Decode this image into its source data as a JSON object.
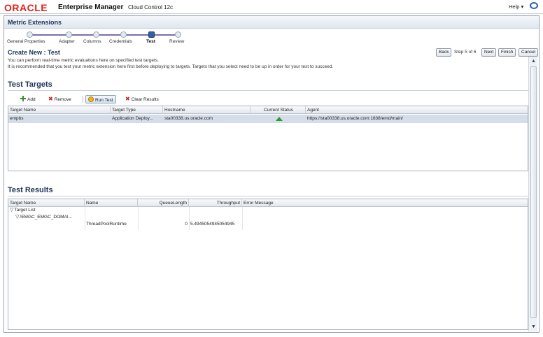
{
  "header": {
    "logo": "ORACLE",
    "product": "Enterprise Manager",
    "edition": "Cloud Control 12c",
    "help": "Help ▾"
  },
  "region": {
    "title": "Metric Extensions"
  },
  "train": {
    "steps": [
      {
        "label": "General Properties",
        "active": false
      },
      {
        "label": "Adapter",
        "active": false
      },
      {
        "label": "Columns",
        "active": false
      },
      {
        "label": "Credentials",
        "active": false
      },
      {
        "label": "Test",
        "active": true
      },
      {
        "label": "Review",
        "active": false
      }
    ]
  },
  "page": {
    "title": "Create New : Test",
    "desc1": "You can perform real-time metric evaluations here on specified test targets.",
    "desc2": "It is recommended that you test your metric extension here first before deploying to targets. Targets that you select need to be up in order for your test to succeed."
  },
  "nav": {
    "back": "Back",
    "step": "Step 5 of 6",
    "next": "Next",
    "finish": "Finish",
    "cancel": "Cancel"
  },
  "targets": {
    "title": "Test Targets",
    "toolbar": {
      "add": "Add",
      "remove": "Remove",
      "run": "Run Test",
      "clear": "Clear Results"
    },
    "columns": [
      "Target Name",
      "Target Type",
      "Hostname",
      "Current Status",
      "Agent"
    ],
    "rows": [
      {
        "name": "empbs",
        "type": "Application Deploy...",
        "host": "sta00338.us.oracle.com",
        "status": "up",
        "agent": "https://sta00338.us.oracle.com:1838/emd/main/"
      }
    ]
  },
  "results": {
    "title": "Test Results",
    "columns": [
      "Target Name",
      "Name",
      "QueueLength",
      "Throughput",
      "Error Message"
    ],
    "tree": {
      "root": "Target List",
      "child": "/EMGC_EMGC_DOMAI...",
      "row": {
        "name": "ThreadPoolRuntime",
        "queue": "0",
        "throughput": "5.4945054945054945"
      }
    }
  },
  "colors": {
    "brand": "#e2231a",
    "accent": "#2f62a6",
    "status_up": "#2f9a2f"
  }
}
